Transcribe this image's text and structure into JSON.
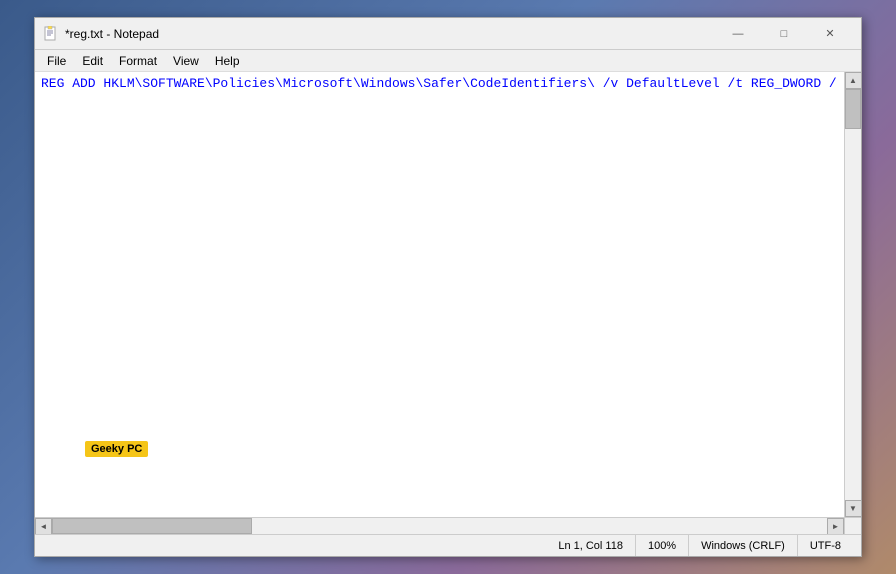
{
  "window": {
    "title": "*reg.txt - Notepad",
    "icon": "notepad-icon"
  },
  "titlebar": {
    "minimize_label": "—",
    "maximize_label": "□",
    "close_label": "✕"
  },
  "menubar": {
    "items": [
      {
        "id": "file",
        "label": "File"
      },
      {
        "id": "edit",
        "label": "Edit"
      },
      {
        "id": "format",
        "label": "Format"
      },
      {
        "id": "view",
        "label": "View"
      },
      {
        "id": "help",
        "label": "Help"
      }
    ]
  },
  "editor": {
    "content": "REG ADD HKLM\\SOFTWARE\\Policies\\Microsoft\\Windows\\Safer\\CodeIdentifiers\\ /v DefaultLevel /t REG_DWORD /"
  },
  "scrollbar": {
    "up_arrow": "▲",
    "down_arrow": "▼",
    "left_arrow": "◄",
    "right_arrow": "►"
  },
  "statusbar": {
    "position": "Ln 1, Col 118",
    "zoom": "100%",
    "line_ending": "Windows (CRLF)",
    "encoding": "UTF-8"
  },
  "watermark": {
    "label": "Geeky PC"
  }
}
